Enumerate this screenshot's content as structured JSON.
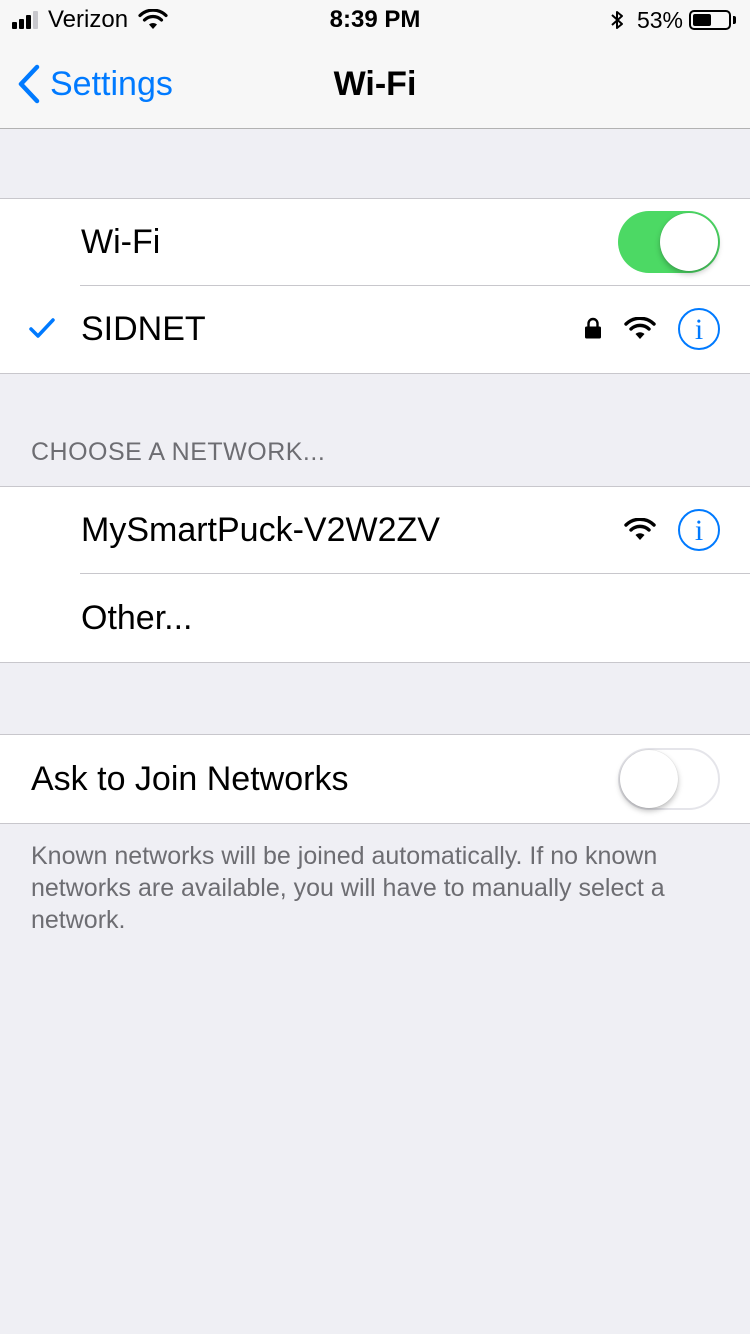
{
  "status_bar": {
    "carrier": "Verizon",
    "signal_bars_filled": 3,
    "signal_bars_total": 4,
    "time": "8:39 PM",
    "battery_percent": "53%",
    "battery_level": 0.53
  },
  "nav": {
    "back_label": "Settings",
    "title": "Wi-Fi"
  },
  "wifi_group": {
    "toggle_label": "Wi-Fi",
    "toggle_on": true,
    "connected_network": "SIDNET",
    "connected_secured": true
  },
  "networks_section": {
    "header": "CHOOSE A NETWORK...",
    "networks": [
      {
        "name": "MySmartPuck-V2W2ZV",
        "secured": false
      }
    ],
    "other_label": "Other..."
  },
  "ask_to_join": {
    "label": "Ask to Join Networks",
    "toggle_on": false,
    "footer": "Known networks will be joined automatically. If no known networks are available, you will have to manually select a network."
  },
  "colors": {
    "accent": "#007aff",
    "toggle_on": "#4cd964",
    "background": "#efeff4"
  },
  "icons": {
    "info": "i"
  }
}
